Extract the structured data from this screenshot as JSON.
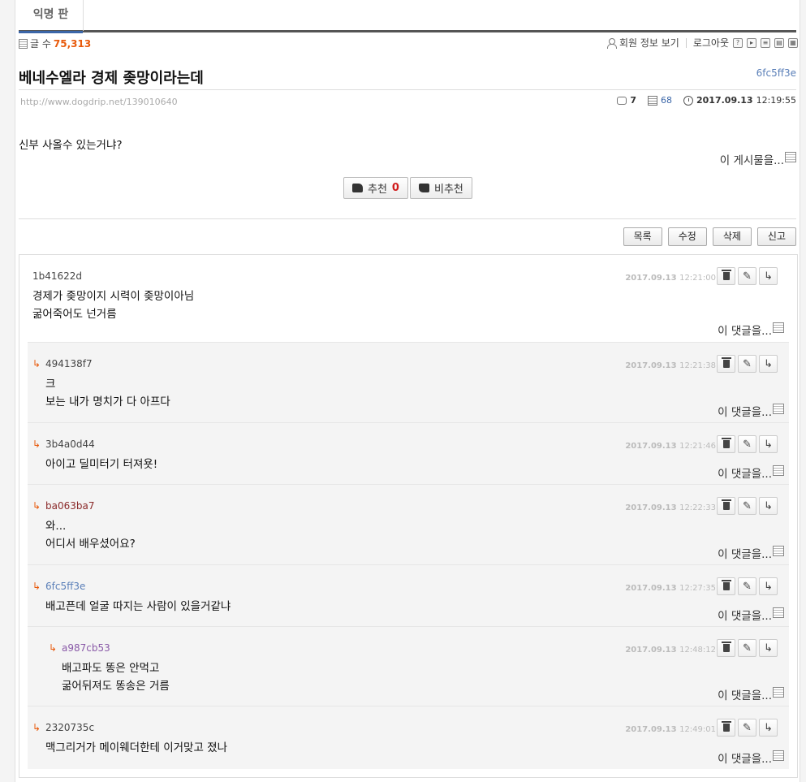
{
  "board": {
    "tab_label": "익명 판"
  },
  "stats": {
    "label": "글 수",
    "count": "75,313"
  },
  "topmenu": {
    "member_info": "회원 정보 보기",
    "logout": "로그아웃"
  },
  "post": {
    "title": "베네수엘라 경제 좆망이라는데",
    "author": "6fc5ff3e",
    "url": "http://www.dogdrip.net/139010640",
    "comments_count": "7",
    "views": "68",
    "date": "2017.09.13",
    "time": "12:19:55",
    "body": "신부 사올수 있는거냐?",
    "this_post": "이 게시물을..."
  },
  "vote": {
    "up_label": "추천",
    "up_count": "0",
    "down_label": "비추천"
  },
  "actions": {
    "list": "목록",
    "edit": "수정",
    "delete": "삭제",
    "report": "신고"
  },
  "comment_menu_label": "이 댓글을...",
  "colors": {
    "accent": "#e85a0c",
    "blue": "#3b66a8"
  },
  "comments": [
    {
      "author": "1b41622d",
      "author_color": "#444444",
      "date": "2017.09.13",
      "time": "12:21:00",
      "lines": [
        "경제가 좆망이지 시력이 좆망이아님",
        "굶어죽어도 넌거름"
      ]
    },
    {
      "author": "494138f7",
      "author_color": "#444444",
      "date": "2017.09.13",
      "time": "12:21:38",
      "lines": [
        "크",
        "보는 내가 명치가 다 아프다"
      ]
    },
    {
      "author": "3b4a0d44",
      "author_color": "#444444",
      "date": "2017.09.13",
      "time": "12:21:46",
      "lines": [
        "아이고 딜미터기 터져욧!"
      ]
    },
    {
      "author": "ba063ba7",
      "author_color": "#8b2a2a",
      "date": "2017.09.13",
      "time": "12:22:33",
      "lines": [
        "와...",
        "어디서 배우셨어요?"
      ]
    },
    {
      "author": "6fc5ff3e",
      "author_color": "#5a7fb8",
      "date": "2017.09.13",
      "time": "12:27:35",
      "lines": [
        "배고픈데 얼굴 따지는 사람이 있을거같냐"
      ]
    },
    {
      "author": "a987cb53",
      "author_color": "#8a5aa8",
      "date": "2017.09.13",
      "time": "12:48:12",
      "lines": [
        "배고파도 똥은 안먹고",
        "굶어뒤져도 똥송은 거름"
      ]
    },
    {
      "author": "2320735c",
      "author_color": "#444444",
      "date": "2017.09.13",
      "time": "12:49:01",
      "lines": [
        "맥그리거가 메이웨더한테 이거맞고 졌나"
      ]
    }
  ]
}
